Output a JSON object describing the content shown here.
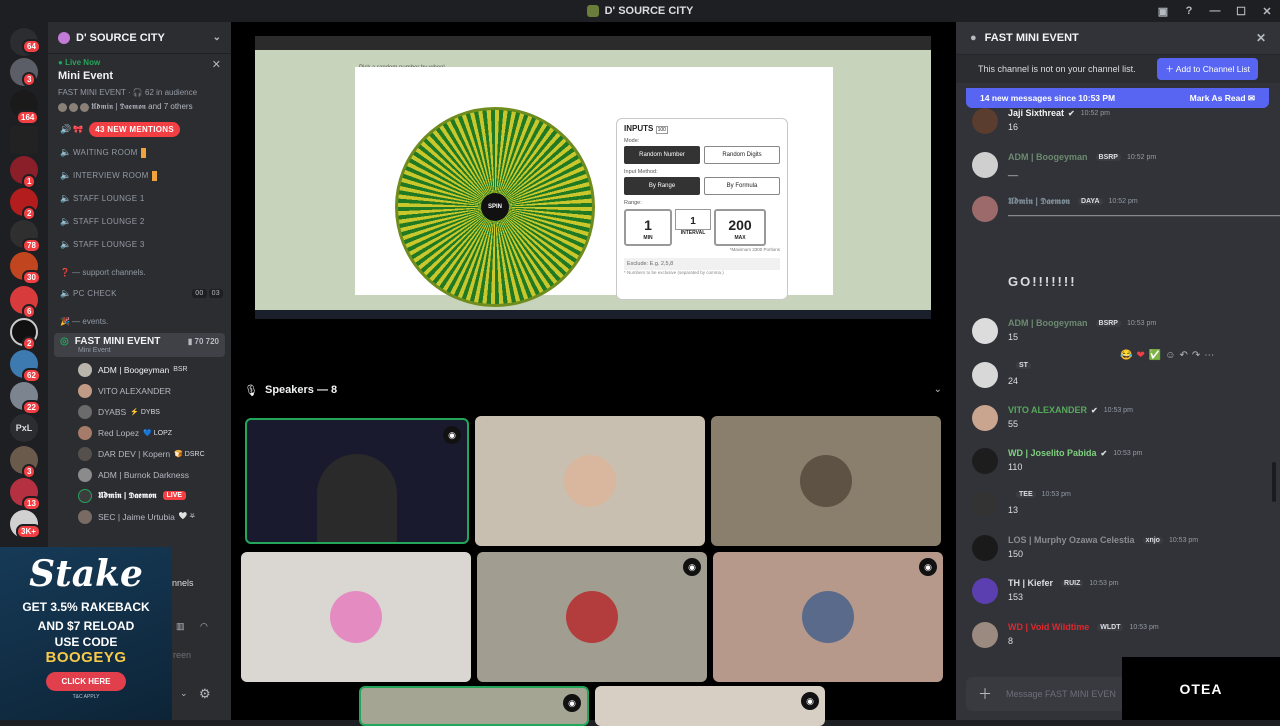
{
  "window": {
    "title": "D' SOURCE CITY"
  },
  "rail_badges": [
    "64",
    "3",
    "164",
    "1",
    "2",
    "78",
    "30",
    "6",
    "2",
    "62",
    "22",
    "3",
    "13",
    "3K+"
  ],
  "rail_text_label": "PxL",
  "channels": {
    "server_name": "D' SOURCE CITY",
    "live_now": "Live Now",
    "live_title": "Mini Event",
    "live_sub": "FAST MINI EVENT · 🎧 62 in audience",
    "live_people": "𝖀𝖉𝖒𝖎𝖓 | 𝕯𝖆𝖊𝖒𝖔𝖓 and 7 others",
    "mentions": "43 NEW MENTIONS",
    "rows": [
      {
        "label": "WAITING ROOM",
        "orange": true
      },
      {
        "label": "INTERVIEW ROOM",
        "orange": true
      },
      {
        "label": "STAFF LOUNGE 1",
        "orange": false
      },
      {
        "label": "STAFF LOUNGE 2",
        "orange": false
      },
      {
        "label": "STAFF LOUNGE 3",
        "orange": false
      }
    ],
    "cat_support": "❓ — support channels.",
    "pc_check": "PC CHECK",
    "pc_count_a": "00",
    "pc_count_b": "03",
    "cat_events": "🎉 — events.",
    "voice_name": "FAST MINI EVENT",
    "voice_sub": "Mini Event",
    "voice_count_a": "70",
    "voice_count_b": "720",
    "members": [
      {
        "name": "ADM | Boogeyman",
        "tag": "BSR"
      },
      {
        "name": "VITO ALEXANDER",
        "tag": ""
      },
      {
        "name": "DYABS",
        "tag": "⚡ DYBS"
      },
      {
        "name": "Red Lopez",
        "tag": "💙 LOPZ"
      },
      {
        "name": "DAR DEV | Kopern",
        "tag": "🍞 DSRC"
      },
      {
        "name": "ADM | Burnok Darkness",
        "tag": ""
      },
      {
        "name": "𝖀𝖉𝖒𝖎𝖓 | 𝕯𝖆𝖊𝖒𝖔𝖓",
        "tag": "",
        "live": "LIVE"
      },
      {
        "name": "SEC | Jaime Urtubia",
        "tag": "🤍 ⛧"
      }
    ],
    "partial_a": "nnels",
    "partial_b": "reen"
  },
  "ad": {
    "logo": "Stake",
    "line1": "GET 3.5% RAKEBACK",
    "line2": "AND $7 RELOAD",
    "line3": "USE CODE",
    "code": "BOOGEYG",
    "button": "CLICK HERE",
    "tc": "T&C APPLY"
  },
  "screen": {
    "hint": "Pick a random number by wheel",
    "spin": "SPIN",
    "inputs_title": "INPUTS",
    "inputs_badge": "100",
    "mode_label": "Mode:",
    "mode_a": "Random Number",
    "mode_b": "Random Digits",
    "method_label": "Input Method:",
    "method_a": "By Range",
    "method_b": "By Formula",
    "range_label": "Range:",
    "min": "1",
    "min_cap": "MIN",
    "interval": "1",
    "interval_cap": "INTERVAL",
    "max": "200",
    "max_cap": "MAX",
    "max_note": "*Maximum 3300 Portions",
    "exclude": "Exclude:  E.g. 2,5,8",
    "exclude_note": "* Numbers to be exclusive (separated by comma.)"
  },
  "speakers": {
    "label": "Speakers — 8"
  },
  "chat": {
    "title": "FAST MINI EVENT",
    "not_in_list": "This channel is not on your channel list.",
    "add_btn": "Add to Channel List",
    "new_msgs": "14 new messages since 10:53 PM",
    "mark_read": "Mark As Read",
    "input_placeholder": "Message FAST MINI EVEN",
    "messages": [
      {
        "name": "Jaji Sixthreat",
        "color": "#f2f3f5",
        "check": "✔",
        "tag": "",
        "time": "10:52 pm",
        "text": "16"
      },
      {
        "name": "ADM | Boogeyman",
        "color": "#6c8a6f",
        "check": "",
        "tag": "BSRP",
        "time": "10:52 pm",
        "text": "__"
      },
      {
        "name": "𝖀𝖉𝖒𝖎𝖓 | 𝕯𝖆𝖊𝖒𝖔𝖓",
        "color": "#7d8b96",
        "check": "",
        "tag": "DAYA",
        "time": "10:52 pm",
        "text": "—————————————————————————————————"
      },
      {
        "name": "ADM | Boogeyman",
        "color": "#6c8a6f",
        "check": "",
        "tag": "BSRP",
        "time": "10:53 pm",
        "text": "15"
      },
      {
        "name": "",
        "color": "#f2f3f5",
        "check": "",
        "tag": "ST",
        "time": "",
        "text": "24"
      },
      {
        "name": "VITO ALEXANDER",
        "color": "#58a85c",
        "check": "✔",
        "tag": "",
        "time": "10:53 pm",
        "text": "55"
      },
      {
        "name": "WD | Joselito Pabida",
        "color": "#7fd17f",
        "check": "✔",
        "tag": "",
        "time": "10:53 pm",
        "text": "110"
      },
      {
        "name": "",
        "color": "#f2f3f5",
        "check": "",
        "tag": "TEE",
        "time": "10:53 pm",
        "text": "13"
      },
      {
        "name": "LOS | Murphy Ozawa Celestia",
        "color": "#8a8c91",
        "check": "",
        "tag": "xnjo",
        "time": "10:53 pm",
        "text": "150"
      },
      {
        "name": "TH | Kiefer",
        "color": "#dbdee1",
        "check": "",
        "tag": "RUIZ",
        "time": "10:53 pm",
        "text": "153"
      },
      {
        "name": "WD | Void Wildtime",
        "color": "#e0282e",
        "check": "",
        "tag": "WLDT",
        "time": "10:53 pm",
        "text": "8"
      }
    ],
    "go_text": "GO!!!!!!!"
  },
  "watermark": "ОТЕА",
  "colors": {
    "accent": "#5865f2",
    "danger": "#f23f43",
    "online": "#23a55a"
  }
}
